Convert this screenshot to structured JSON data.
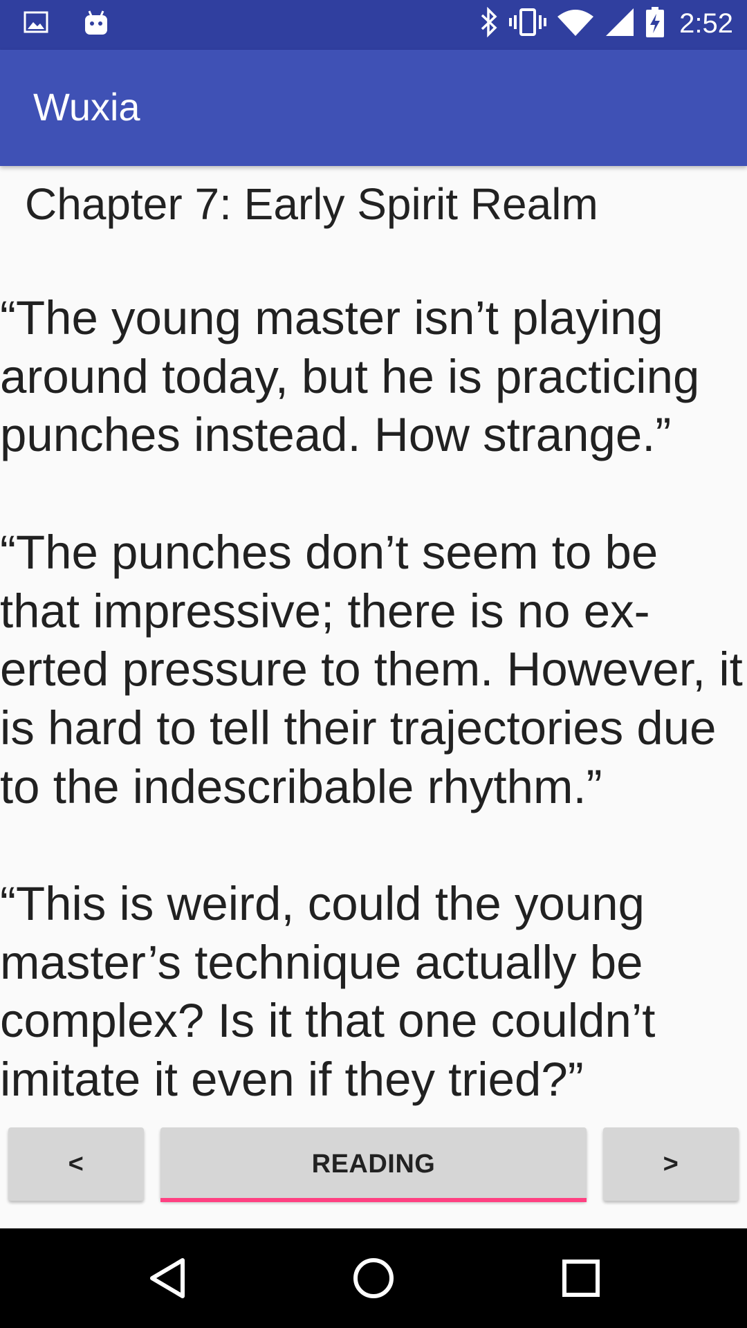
{
  "status_bar": {
    "time": "2:52",
    "left_icons": [
      "image-icon",
      "android-icon"
    ],
    "right_icons": [
      "bluetooth-icon",
      "vibrate-icon",
      "wifi-icon",
      "cell-signal-icon",
      "battery-charging-icon"
    ]
  },
  "app_bar": {
    "title": "Wuxia"
  },
  "chapter": {
    "title": "Chapter 7: Early Spirit Realm",
    "text": "“The young master isn’t playing around today, but he is practicing punches instead. How strange.”\n\n“The punches don’t seem to be that impressive; there is no ex-erted pressure to them. However, it is hard to tell their trajectories due to the indescribable rhythm.”\n\n“This is weird, could the young master’s technique actually be complex? Is it that one couldn’t imitate it even if they tried?”"
  },
  "bottom_buttons": {
    "prev_label": "<",
    "reading_label": "READING",
    "next_label": ">"
  },
  "colors": {
    "status_bar": "#303f9f",
    "app_bar": "#3f51b5",
    "accent": "#ff4081",
    "button_bg": "#d6d6d6"
  },
  "system_nav": [
    "back-icon",
    "home-icon",
    "recents-icon"
  ]
}
